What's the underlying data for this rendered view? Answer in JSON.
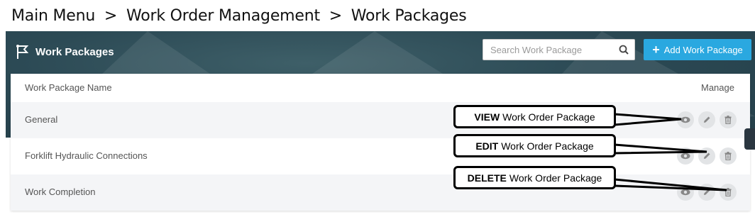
{
  "breadcrumb": {
    "items": [
      "Main Menu",
      ">",
      "Work Order Management",
      ">",
      "Work Packages"
    ]
  },
  "header": {
    "title": "Work Packages",
    "icon": "flag-icon"
  },
  "search": {
    "placeholder": "Search Work Package",
    "icon": "search-icon"
  },
  "toolbar": {
    "add_label": "Add Work Package"
  },
  "table": {
    "columns": [
      "Work Package Name",
      "Manage"
    ],
    "rows": [
      {
        "name": "General"
      },
      {
        "name": "Forklift Hydraulic Connections"
      },
      {
        "name": "Work Completion"
      }
    ],
    "actions": [
      "view-icon",
      "edit-icon",
      "delete-icon"
    ]
  },
  "callouts": {
    "view": {
      "bold": "VIEW",
      "text": "Work Order Package"
    },
    "edit": {
      "bold": "EDIT",
      "text": "Work Order Package"
    },
    "delete": {
      "bold": "DELETE",
      "text": "Work Order Package"
    }
  },
  "colors": {
    "accent": "#2aa8e0",
    "banner": "#2c4a55",
    "row_alt": "#f4f5f7"
  }
}
